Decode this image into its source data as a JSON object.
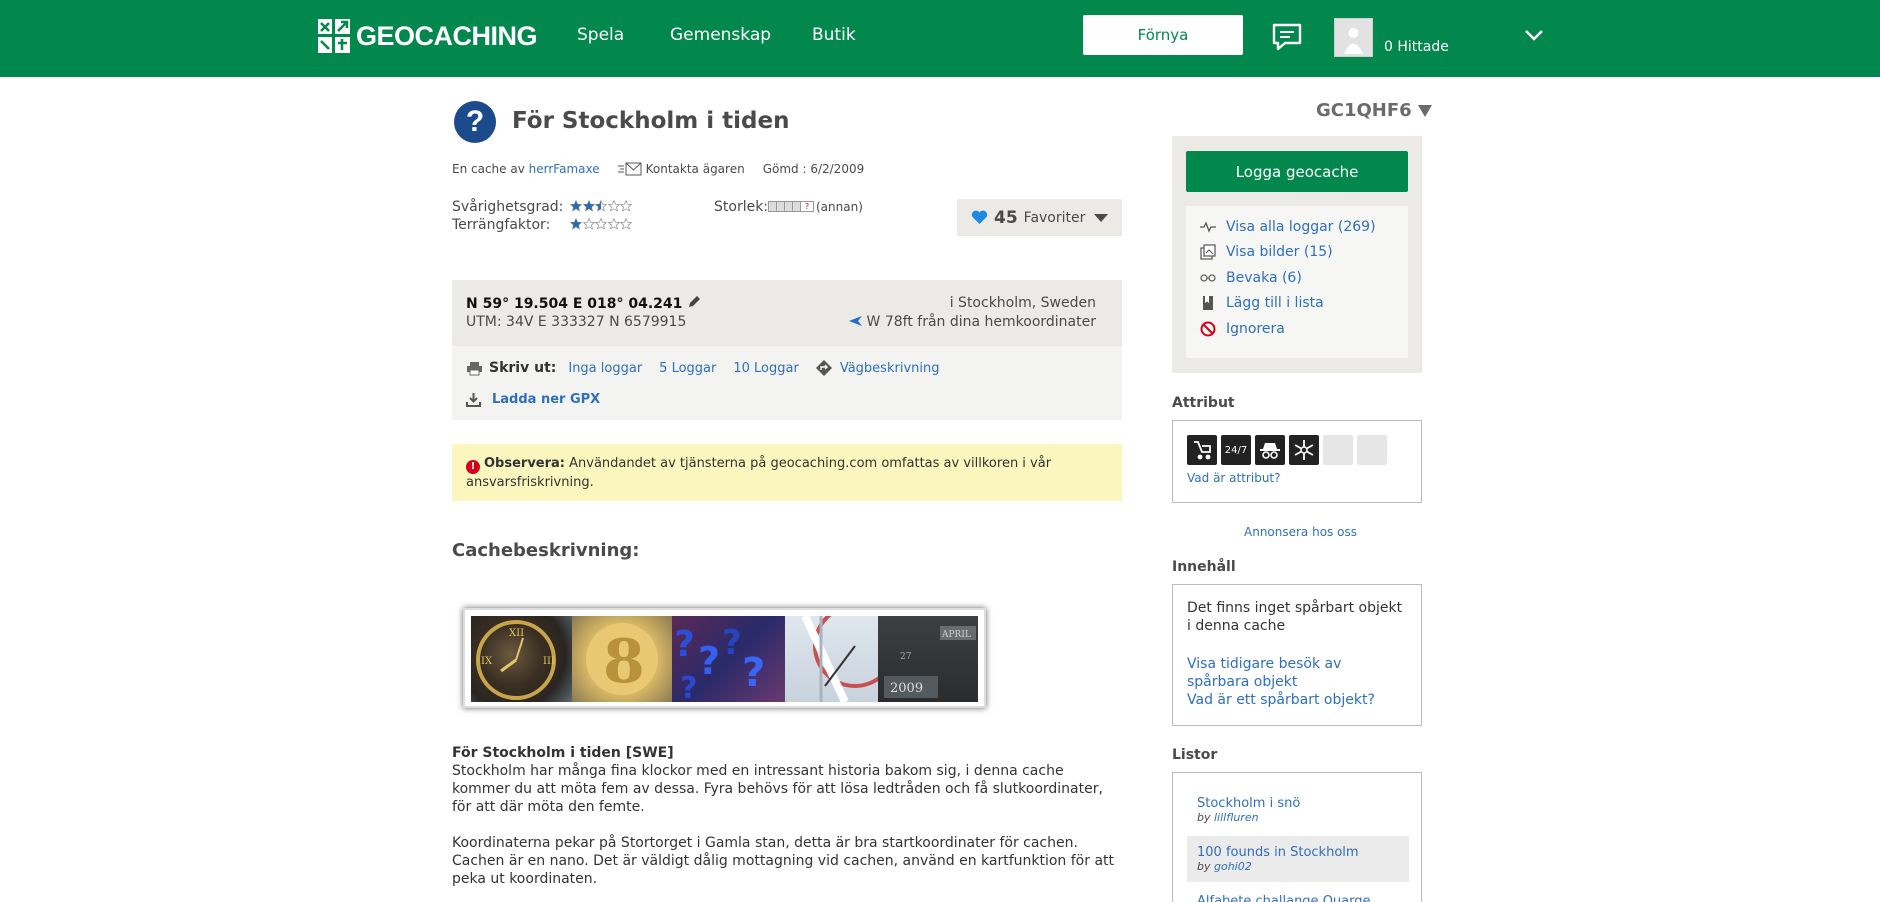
{
  "header": {
    "logo_text": "GEOCACHING",
    "nav": [
      "Spela",
      "Gemenskap",
      "Butik"
    ],
    "renew_label": "Förnya",
    "finds": "0 Hittade",
    "colors": {
      "brand": "#02874d"
    }
  },
  "cache": {
    "type_icon": "?",
    "title": "För Stockholm i tiden",
    "by_prefix": "En cache av",
    "owner": "herrFamaxe",
    "contact": "Kontakta ägaren",
    "hidden": "Gömd : 6/2/2009",
    "difficulty_label": "Svårighetsgrad:",
    "terrain_label": "Terrängfaktor:",
    "difficulty": 2.5,
    "terrain": 1,
    "size_label": "Storlek:",
    "size_text": "(annan)",
    "favorites_count": "45",
    "favorites_label": "Favoriter"
  },
  "coords": {
    "main": "N 59° 19.504 E 018° 04.241",
    "utm": "UTM: 34V E 333327 N 6579915",
    "location": "i Stockholm, Sweden",
    "distance": "W 78ft från dina hemkoordinater"
  },
  "print": {
    "label": "Skriv ut:",
    "options": [
      "Inga loggar",
      "5 Loggar",
      "10 Loggar"
    ],
    "directions": "Vägbeskrivning",
    "gpx": "Ladda ner GPX"
  },
  "notice": {
    "title": "Observera:",
    "text": " Användandet av tjänsterna på geocaching.com omfattas av villkoren i vår ansvarsfriskrivning."
  },
  "description": {
    "heading": "Cachebeskrivning:",
    "subtitle": "För Stockholm i tiden [SWE]",
    "para1": "Stockholm har många fina klockor med en intressant historia bakom sig, i denna cache kommer du att möta fem av dessa. Fyra behövs för att lösa ledtråden och få slutkoordinater, för att där möta den femte.",
    "para2": "Koordinaterna pekar på Stortorget i Gamla stan, detta är bra startkoordinater för cachen. Cachen är en nano. Det är väldigt dålig mottagning vid cachen, använd en kartfunktion för att peka ut koordinaten.",
    "banner_text": [
      "2009",
      "APRIL",
      "27"
    ]
  },
  "sidebar": {
    "gc_code": "GC1QHF6",
    "log_button": "Logga geocache",
    "links": [
      {
        "label": "Visa alla loggar (269)",
        "icon": "activity-icon"
      },
      {
        "label": "Visa bilder (15)",
        "icon": "images-icon"
      },
      {
        "label": "Bevaka (6)",
        "icon": "glasses-icon"
      },
      {
        "label": "Lägg till i lista",
        "icon": "bookmark-icon"
      },
      {
        "label": "Ignorera",
        "icon": "ban-icon"
      }
    ],
    "attributes_heading": "Attribut",
    "attributes": [
      "stroller-icon",
      "24/7",
      "incognito-icon",
      "snowflake-icon"
    ],
    "attributes_link": "Vad är attribut?",
    "advertise": "Annonsera hos oss",
    "contents_heading": "Innehåll",
    "contents_text": "Det finns inget spårbart objekt i denna cache",
    "contents_link1": "Visa tidigare besök av spårbara objekt",
    "contents_link2": "Vad är ett spårbart objekt?",
    "lists_heading": "Listor",
    "lists": [
      {
        "title": "Stockholm i snö",
        "by": "by",
        "author": "lillfluren"
      },
      {
        "title": "100 founds in Stockholm",
        "by": "by",
        "author": "gohi02"
      },
      {
        "title": "Alfabete challange Quarge",
        "by": "",
        "author": ""
      }
    ]
  }
}
